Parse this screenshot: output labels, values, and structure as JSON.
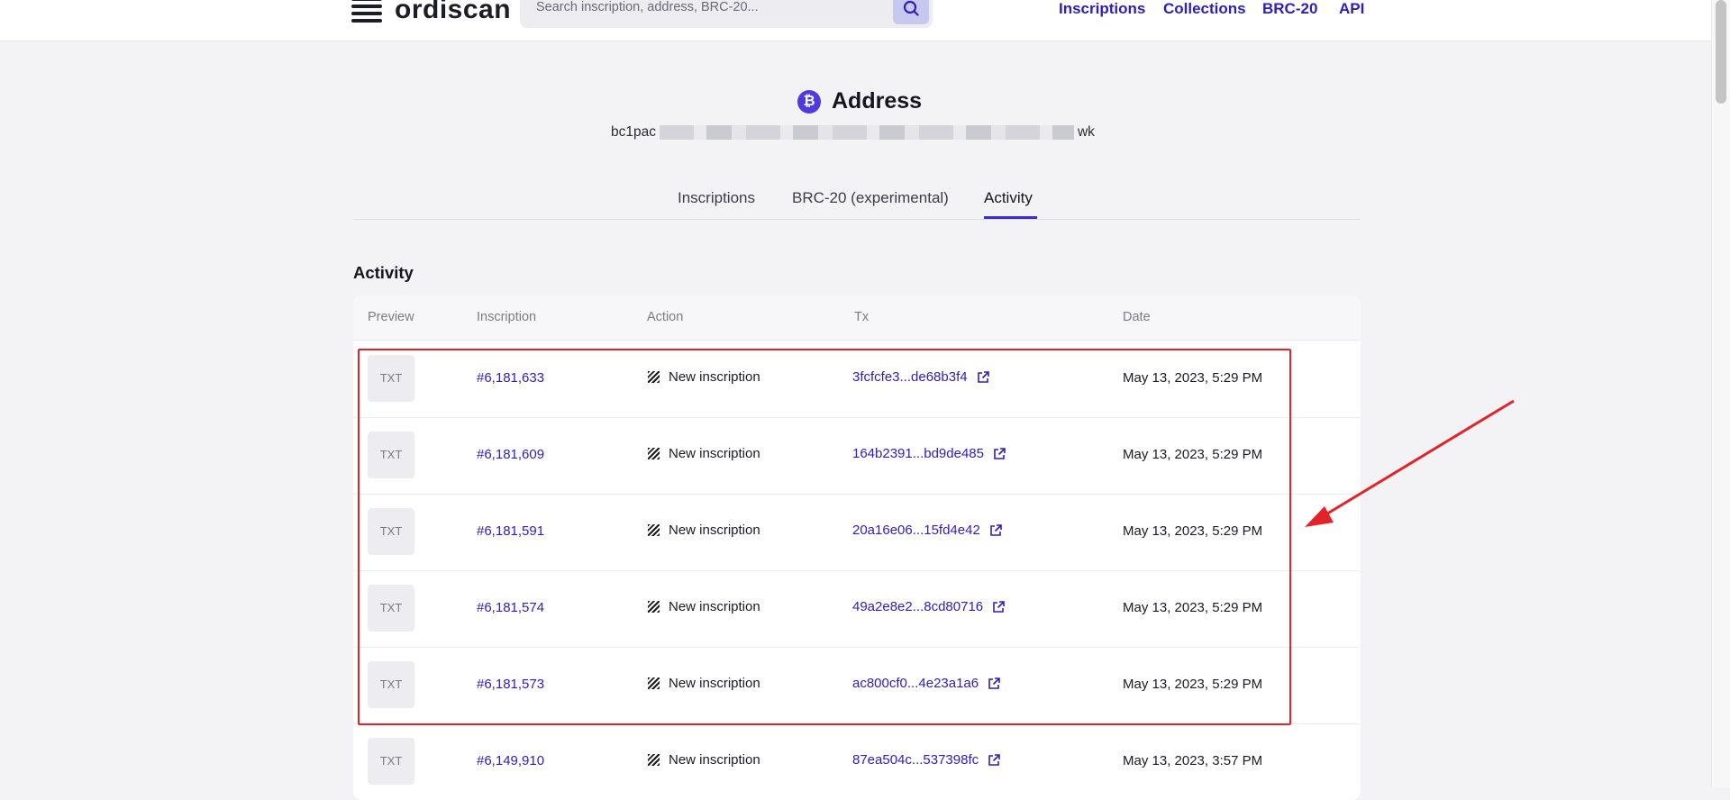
{
  "header": {
    "logo_text": "ordiscan",
    "search_placeholder": "Search inscription, address, BRC-20...",
    "nav": [
      "Inscriptions",
      "Collections",
      "BRC-20",
      "API"
    ]
  },
  "address": {
    "title": "Address",
    "prefix": "bc1pac",
    "suffix": "wk"
  },
  "tabs": [
    "Inscriptions",
    "BRC-20 (experimental)",
    "Activity"
  ],
  "activity": {
    "title": "Activity",
    "columns": [
      "Preview",
      "Inscription",
      "Action",
      "Tx",
      "Date"
    ],
    "rows": [
      {
        "preview": "TXT",
        "inscription": "#6,181,633",
        "action": "New inscription",
        "tx": "3fcfcfe3...de68b3f4",
        "date": "May 13, 2023, 5:29 PM"
      },
      {
        "preview": "TXT",
        "inscription": "#6,181,609",
        "action": "New inscription",
        "tx": "164b2391...bd9de485",
        "date": "May 13, 2023, 5:29 PM"
      },
      {
        "preview": "TXT",
        "inscription": "#6,181,591",
        "action": "New inscription",
        "tx": "20a16e06...15fd4e42",
        "date": "May 13, 2023, 5:29 PM"
      },
      {
        "preview": "TXT",
        "inscription": "#6,181,574",
        "action": "New inscription",
        "tx": "49a2e8e2...8cd80716",
        "date": "May 13, 2023, 5:29 PM"
      },
      {
        "preview": "TXT",
        "inscription": "#6,181,573",
        "action": "New inscription",
        "tx": "ac800cf0...4e23a1a6",
        "date": "May 13, 2023, 5:29 PM"
      },
      {
        "preview": "TXT",
        "inscription": "#6,149,910",
        "action": "New inscription",
        "tx": "87ea504c...537398fc",
        "date": "May 13, 2023, 3:57 PM"
      }
    ]
  },
  "colors": {
    "accent": "#2d1fb8",
    "annotation": "#e2232a",
    "background": "#f3f3f6"
  }
}
